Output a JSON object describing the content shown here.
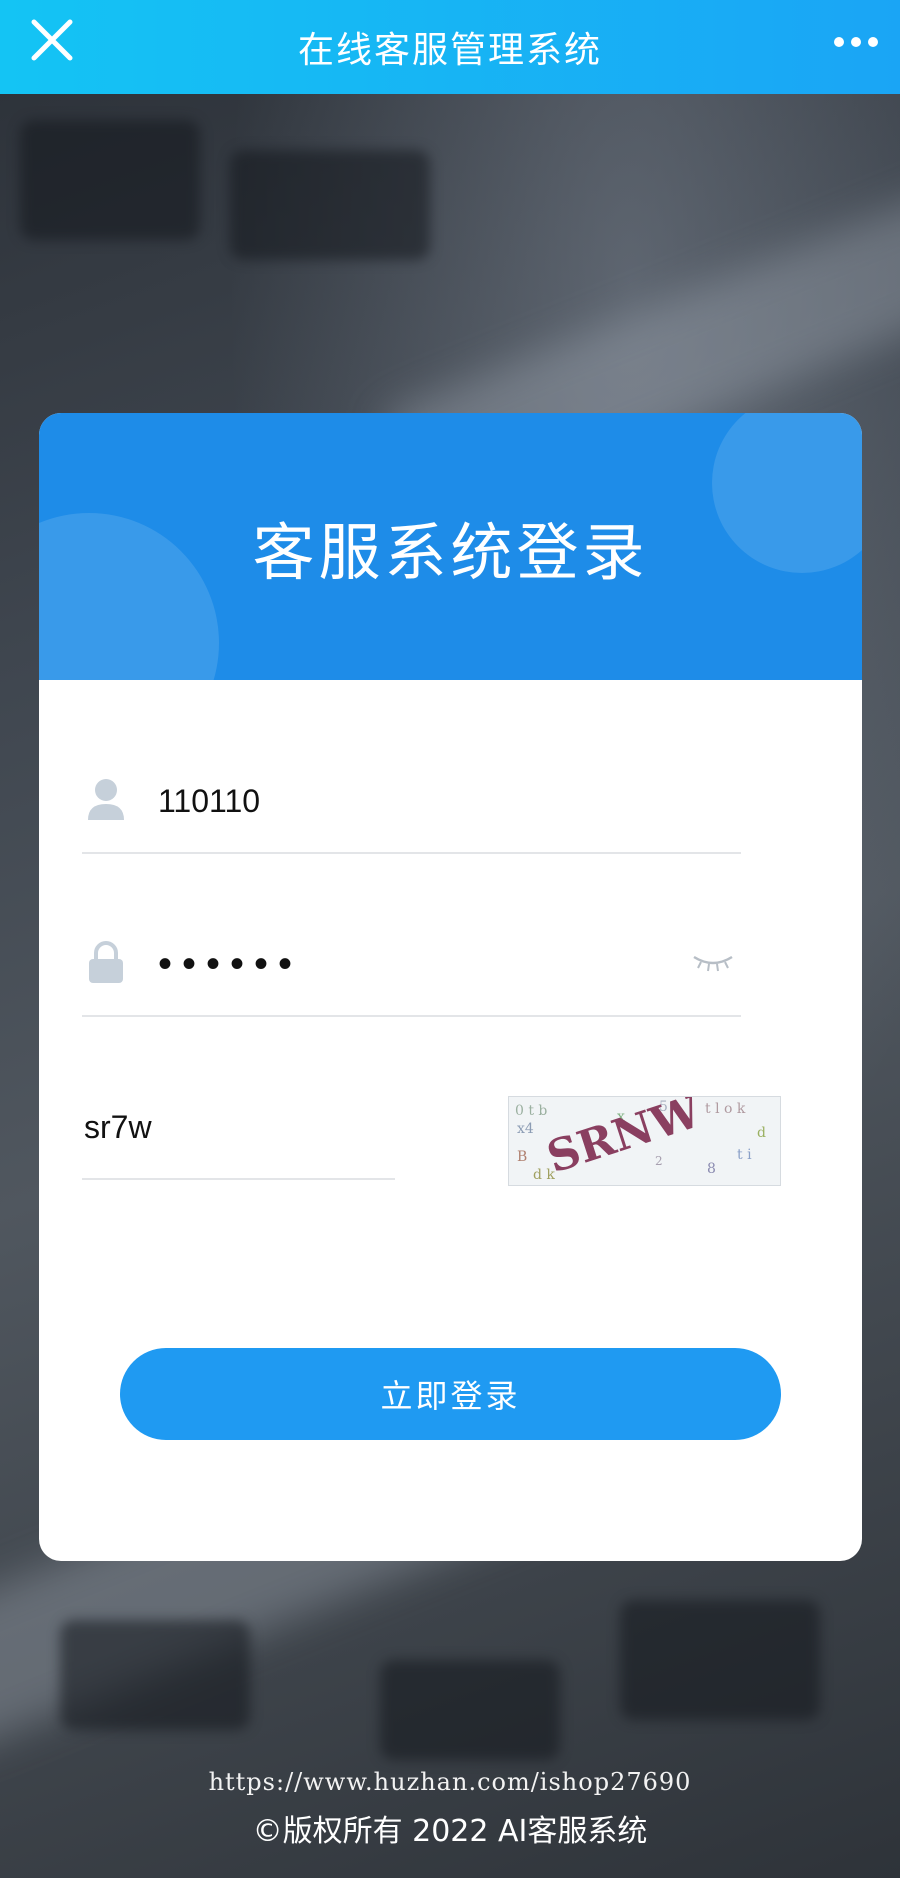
{
  "topbar": {
    "title": "在线客服管理系统"
  },
  "card": {
    "title": "客服系统登录"
  },
  "form": {
    "username_value": "110110",
    "password_value": "••••••",
    "captcha_input_value": "sr7w",
    "captcha_image_text": "SRNW",
    "login_label": "立即登录"
  },
  "footer": {
    "url": "https://www.huzhan.com/ishop27690",
    "copyright": "©版权所有 2022 AI客服系统"
  },
  "colors": {
    "topbar": "#16b6f4",
    "card_header": "#1e8ce8",
    "button": "#1f9af2",
    "captcha_text": "#8a3f60"
  },
  "icons": [
    "close-icon",
    "more-icon",
    "user-icon",
    "lock-icon",
    "eye-closed-icon"
  ]
}
